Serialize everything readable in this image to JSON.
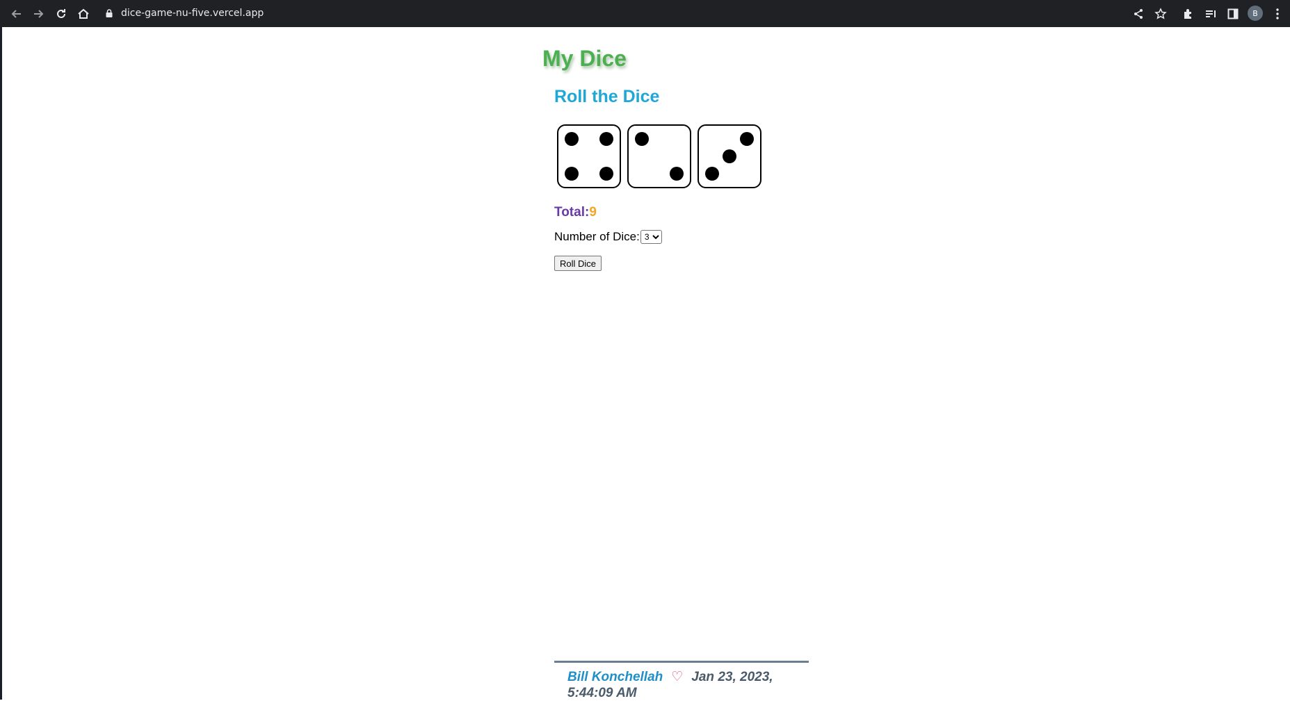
{
  "browser": {
    "url": "dice-game-nu-five.vercel.app",
    "profile_initial": "B",
    "icons": {
      "back": "arrow-left-icon",
      "forward": "arrow-right-icon",
      "reload": "reload-icon",
      "home": "home-icon",
      "lock": "lock-icon",
      "share": "share-icon",
      "bookmark": "star-icon",
      "extensions": "puzzle-icon",
      "reading_list": "reading-list-icon",
      "side_panel": "side-panel-icon",
      "menu": "kebab-menu-icon"
    }
  },
  "page": {
    "title": "My Dice",
    "subtitle": "Roll the Dice",
    "dice_values": [
      4,
      2,
      3
    ],
    "total_label": "Total:",
    "total_value": "9",
    "num_dice_label": "Number of Dice:",
    "num_dice_selected": "3",
    "roll_button_label": "Roll Dice"
  },
  "footer": {
    "author": "Bill Konchellah",
    "heart": "♡",
    "date_line1": "Jan 23, 2023,",
    "date_line2": "5:44:09 AM"
  },
  "colors": {
    "title": "#4caf50",
    "subtitle": "#1fa7d6",
    "total_label": "#6a3aa8",
    "total_value": "#f5a524",
    "author": "#1f8fc7",
    "heart": "#e0407a"
  }
}
